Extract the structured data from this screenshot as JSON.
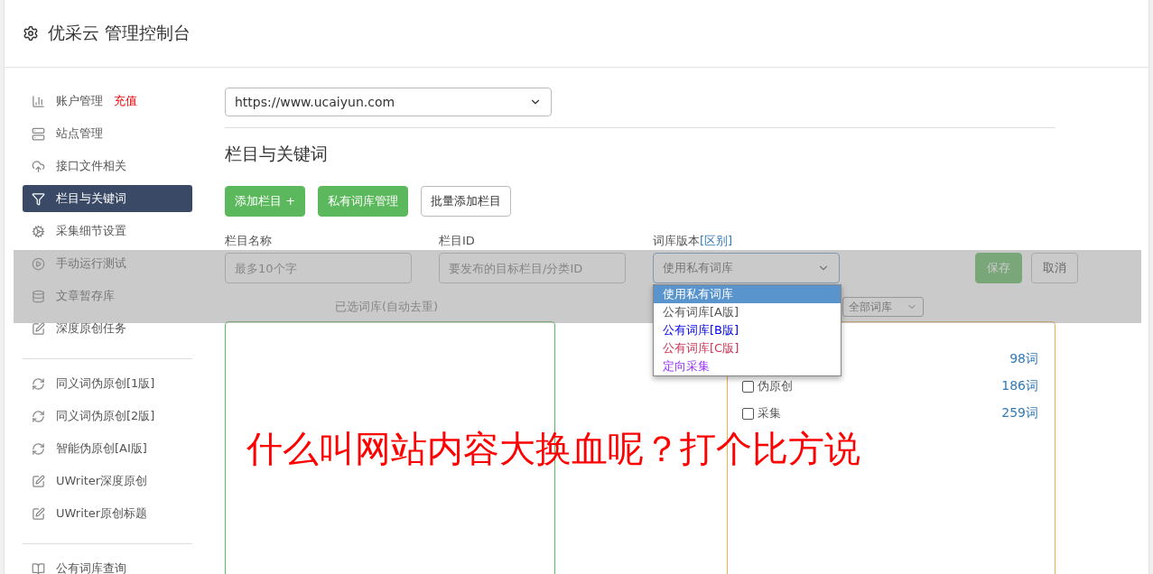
{
  "header": {
    "title": "优采云 管理控制台"
  },
  "sidebar": {
    "groups": [
      {
        "items": [
          {
            "kind": "chart",
            "label": "账户管理",
            "badge": "充值",
            "selected": false
          },
          {
            "kind": "server",
            "label": "站点管理",
            "selected": false
          },
          {
            "kind": "cloud",
            "label": "接口文件相关",
            "selected": false
          },
          {
            "kind": "filter",
            "label": "栏目与关键词",
            "selected": true
          },
          {
            "kind": "gears",
            "label": "采集细节设置",
            "selected": false
          },
          {
            "kind": "play",
            "label": "手动运行测试",
            "selected": false
          },
          {
            "kind": "database",
            "label": "文章暂存库",
            "selected": false
          },
          {
            "kind": "edit",
            "label": "深度原创任务",
            "selected": false
          }
        ]
      },
      {
        "items": [
          {
            "kind": "refresh",
            "label": "同义词伪原创[1版]",
            "selected": false
          },
          {
            "kind": "refresh",
            "label": "同义词伪原创[2版]",
            "selected": false
          },
          {
            "kind": "refresh",
            "label": "智能伪原创[AI版]",
            "selected": false
          },
          {
            "kind": "edit",
            "label": "UWriter深度原创",
            "selected": false
          },
          {
            "kind": "edit",
            "label": "UWriter原创标题",
            "selected": false
          }
        ]
      },
      {
        "items": [
          {
            "kind": "book",
            "label": "公有词库查询",
            "selected": false
          }
        ]
      }
    ]
  },
  "site_select": {
    "value": "https://www.ucaiyun.com"
  },
  "section_title": "栏目与关键词",
  "buttons": [
    {
      "kind": "primary",
      "label": "添加栏目 +"
    },
    {
      "kind": "primary",
      "label": "私有词库管理"
    },
    {
      "kind": "default",
      "label": "批量添加栏目"
    }
  ],
  "form": {
    "name_label": "栏目名称",
    "name_placeholder": "最多10个字",
    "id_label": "栏目ID",
    "id_placeholder": "要发布的目标栏目/分类ID",
    "version_label": "词库版本",
    "version_link": "[区别]",
    "version_value": "使用私有词库",
    "save": "保存",
    "cancel": "取消"
  },
  "version_menu": [
    {
      "label": "使用私有词库",
      "selected": true
    },
    {
      "label": "公有词库[A版]",
      "selected": false,
      "color": "#555555"
    },
    {
      "label": "公有词库[B版]",
      "selected": false,
      "color": "#0000ee"
    },
    {
      "label": "公有词库[C版]",
      "selected": false,
      "color": "#cc3355"
    },
    {
      "label": "定向采集",
      "selected": false,
      "color": "#9933ff"
    }
  ],
  "selected_label": "已选词库(自动去重)",
  "library_filter": "全部词库",
  "libraries": [
    {
      "count": "98词"
    },
    {
      "label": "伪原创",
      "count": "186词",
      "checked": false
    },
    {
      "label": "采集",
      "count": "259词",
      "checked": false
    }
  ],
  "caption": "什么叫网站内容大换血呢？打个比方说"
}
